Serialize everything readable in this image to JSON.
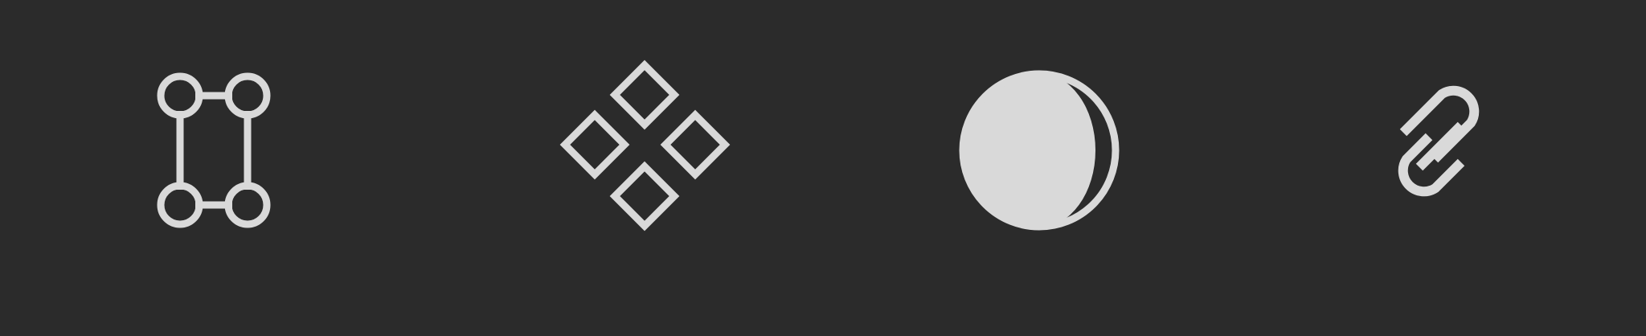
{
  "toolbar": {
    "background": "#2b2b2b",
    "icon_color": "#d9d9d9",
    "tools": [
      {
        "name": "transform",
        "icon": "bounding-box-icon"
      },
      {
        "name": "components",
        "icon": "four-diamonds-icon"
      },
      {
        "name": "appearance",
        "icon": "half-moon-contrast-icon"
      },
      {
        "name": "link",
        "icon": "link-icon"
      }
    ]
  }
}
